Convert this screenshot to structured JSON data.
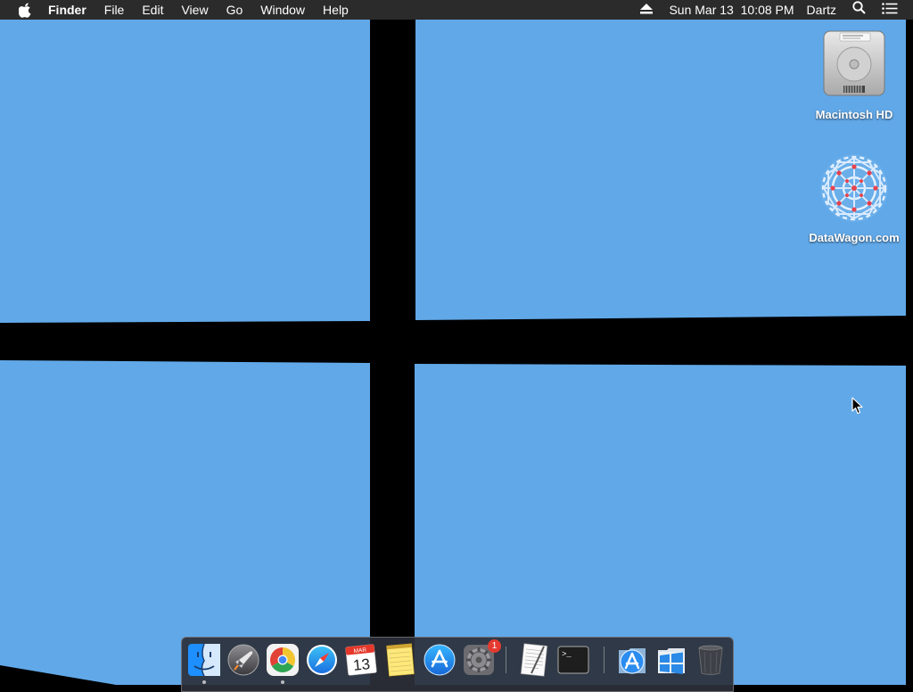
{
  "menubar": {
    "app_name": "Finder",
    "menus": [
      "File",
      "Edit",
      "View",
      "Go",
      "Window",
      "Help"
    ],
    "clock": "Sun Mar 13  10:08 PM",
    "user": "Dartz",
    "icons": [
      "apple-icon",
      "eject-icon",
      "spotlight-search-icon",
      "notification-center-icon"
    ]
  },
  "desktop": {
    "wallpaper": {
      "pane_color": "#61a8e8",
      "frame_color": "#000000"
    },
    "icons": [
      {
        "label": "Macintosh HD",
        "icon": "hard-drive-icon"
      },
      {
        "label": "DataWagon.com",
        "icon": "datawagon-logo-icon"
      }
    ]
  },
  "dock": {
    "items": [
      {
        "name": "Finder",
        "icon": "finder-icon",
        "running": true
      },
      {
        "name": "Launchpad",
        "icon": "launchpad-icon",
        "running": false
      },
      {
        "name": "Google Chrome",
        "icon": "chrome-icon",
        "running": true
      },
      {
        "name": "Safari",
        "icon": "safari-icon",
        "running": false
      },
      {
        "name": "Calendar",
        "icon": "calendar-icon",
        "month": "MAR",
        "day": "13",
        "running": false
      },
      {
        "name": "Notes",
        "icon": "notes-icon",
        "running": false
      },
      {
        "name": "App Store",
        "icon": "app-store-icon",
        "running": false
      },
      {
        "name": "System Preferences",
        "icon": "system-preferences-icon",
        "badge": "1",
        "running": false
      },
      {
        "name": "TextEdit",
        "icon": "textedit-icon",
        "running": false
      },
      {
        "name": "Terminal",
        "icon": "terminal-icon",
        "prompt": ">_",
        "running": false
      },
      {
        "name": "Applications",
        "icon": "applications-folder-icon"
      },
      {
        "name": "Windows",
        "icon": "windows-logo-icon"
      },
      {
        "name": "Trash",
        "icon": "trash-icon"
      }
    ]
  }
}
